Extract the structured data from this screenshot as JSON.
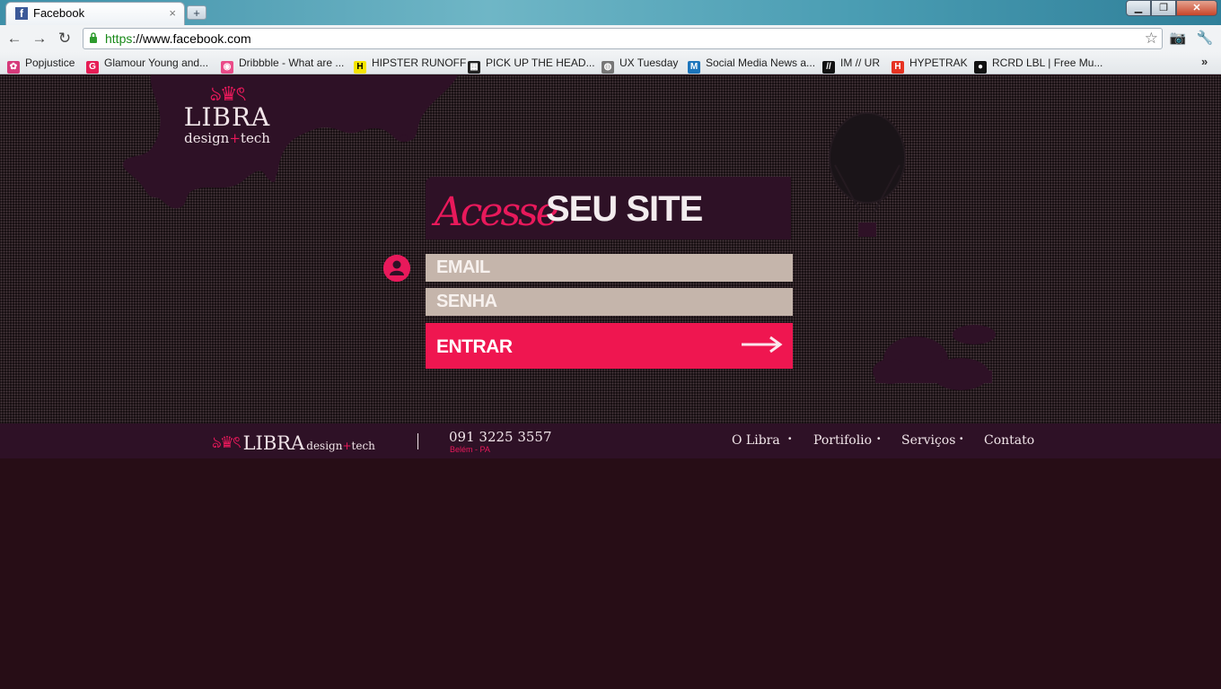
{
  "browser": {
    "tab_title": "Facebook",
    "tab_close": "×",
    "new_tab": "+",
    "url_scheme": "https",
    "url_rest": "://www.facebook.com",
    "bookmarks": [
      {
        "label": "Popjustice",
        "icon": "popjustice-icon",
        "color": "#d63a7a",
        "glyph": "✿"
      },
      {
        "label": "Glamour Young and...",
        "icon": "glamour-icon",
        "color": "#e61d55",
        "glyph": "G"
      },
      {
        "label": "Dribbble - What are ...",
        "icon": "dribbble-icon",
        "color": "#ea4c89",
        "glyph": "◉"
      },
      {
        "label": "HIPSTER RUNOFF",
        "icon": "hipster-runoff-icon",
        "color": "#f5e400",
        "glyph": "H"
      },
      {
        "label": "PICK UP THE HEAD...",
        "icon": "pick-up-the-head-icon",
        "color": "#222222",
        "glyph": "▦"
      },
      {
        "label": "UX Tuesday",
        "icon": "ux-tuesday-icon",
        "color": "#777777",
        "glyph": "◍"
      },
      {
        "label": "Social Media News a...",
        "icon": "mashable-icon",
        "color": "#1c75bc",
        "glyph": "M"
      },
      {
        "label": "IM // UR",
        "icon": "im-ur-icon",
        "color": "#111111",
        "glyph": "//"
      },
      {
        "label": "HYPETRAK",
        "icon": "hypetrak-icon",
        "color": "#e63322",
        "glyph": "H"
      },
      {
        "label": "RCRD LBL | Free Mu...",
        "icon": "rcrd-lbl-icon",
        "color": "#111111",
        "glyph": "●"
      }
    ],
    "bookmarks_more": "»"
  },
  "login": {
    "logo_name": "LIBRA",
    "logo_tag_a": "design",
    "logo_tag_plus": "+",
    "logo_tag_b": "tech",
    "title_script": "Acesse",
    "title_bold": "SEU SITE",
    "email_placeholder": "EMAIL",
    "senha_placeholder": "SENHA",
    "submit_label": "ENTRAR"
  },
  "footer": {
    "logo_name": "LIBRA",
    "logo_tag_a": "design",
    "logo_tag_plus": "+",
    "logo_tag_b": "tech",
    "phone": "091 3225 3557",
    "city": "Belém - PA",
    "nav": [
      "O Libra",
      "Portifolio",
      "Serviços",
      "Contato"
    ]
  },
  "colors": {
    "accent": "#ef1650",
    "panel": "#2e1126",
    "field": "#c5b5ab",
    "background": "#270d16"
  }
}
